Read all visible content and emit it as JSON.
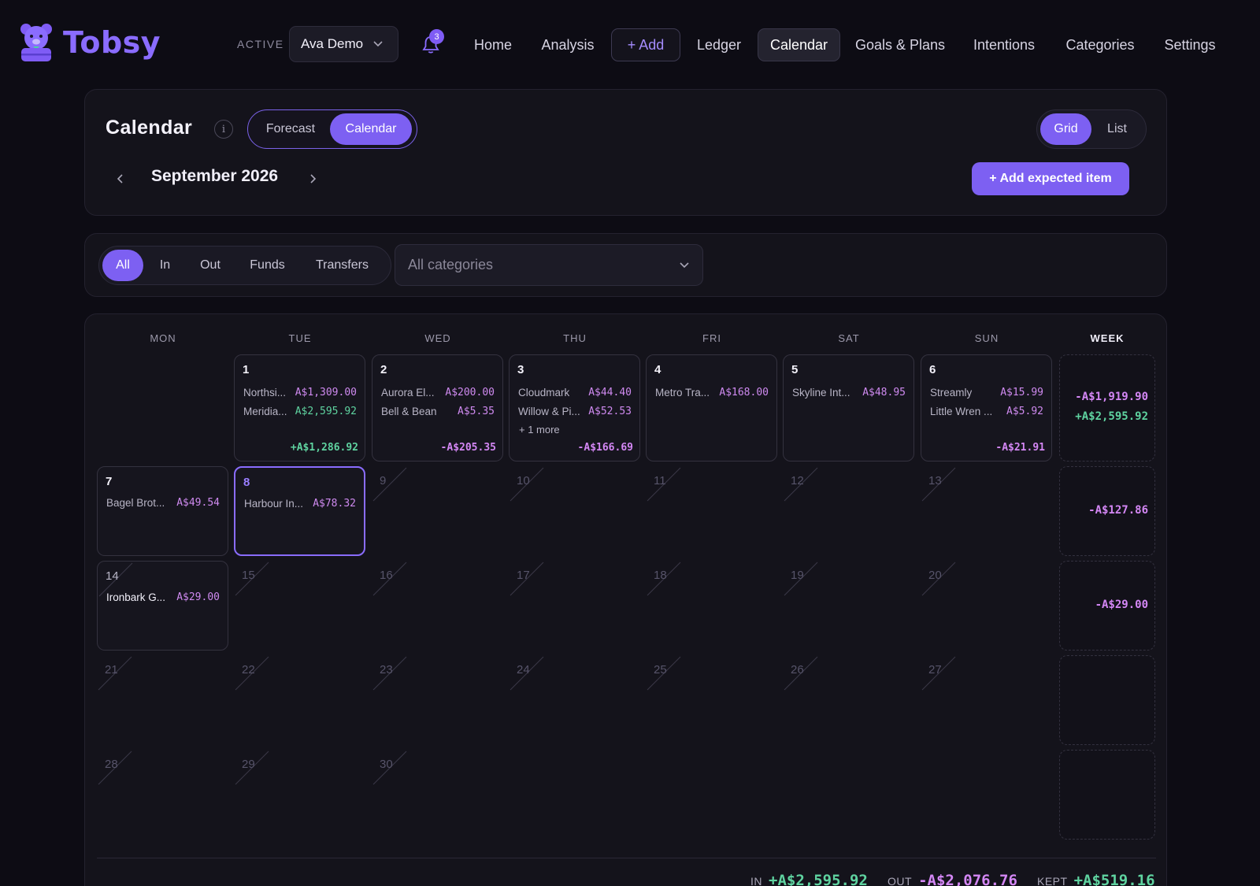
{
  "brand": {
    "name": "Tobsy"
  },
  "account": {
    "label": "ACTIVE",
    "selected": "Ava Demo"
  },
  "notifications": {
    "count": "3"
  },
  "nav": {
    "home": "Home",
    "analysis": "Analysis",
    "add": "+ Add",
    "ledger": "Ledger",
    "calendar": "Calendar",
    "goals": "Goals & Plans",
    "intentions": "Intentions",
    "categories": "Categories",
    "settings": "Settings"
  },
  "header": {
    "title": "Calendar",
    "info": "i",
    "modes": [
      "Forecast",
      "Calendar"
    ],
    "active_mode": "Calendar",
    "views": [
      "Grid",
      "List"
    ],
    "active_view": "Grid",
    "month": "September 2026",
    "add_expected": "+ Add expected item"
  },
  "filters": {
    "types": [
      "All",
      "In",
      "Out",
      "Funds",
      "Transfers"
    ],
    "active_type": "All",
    "category_placeholder": "All categories"
  },
  "weekdays": [
    "MON",
    "TUE",
    "WED",
    "THU",
    "FRI",
    "SAT",
    "SUN",
    "WEEK"
  ],
  "days": {
    "d1": {
      "num": "1",
      "entries": [
        {
          "name": "Northsi...",
          "amount": "A$1,309.00",
          "dir": "out"
        },
        {
          "name": "Meridia...",
          "amount": "A$2,595.92",
          "dir": "in"
        }
      ],
      "total": "+A$1,286.92"
    },
    "d2": {
      "num": "2",
      "entries": [
        {
          "name": "Aurora El...",
          "amount": "A$200.00",
          "dir": "out"
        },
        {
          "name": "Bell & Bean",
          "amount": "A$5.35",
          "dir": "out"
        }
      ],
      "total": "-A$205.35"
    },
    "d3": {
      "num": "3",
      "entries": [
        {
          "name": "Cloudmark",
          "amount": "A$44.40",
          "dir": "out"
        },
        {
          "name": "Willow & Pi...",
          "amount": "A$52.53",
          "dir": "out"
        }
      ],
      "more": "+ 1 more",
      "total": "-A$166.69"
    },
    "d4": {
      "num": "4",
      "entries": [
        {
          "name": "Metro Tra...",
          "amount": "A$168.00",
          "dir": "out"
        }
      ]
    },
    "d5": {
      "num": "5",
      "entries": [
        {
          "name": "Skyline Int...",
          "amount": "A$48.95",
          "dir": "out"
        }
      ]
    },
    "d6": {
      "num": "6",
      "entries": [
        {
          "name": "Streamly",
          "amount": "A$15.99",
          "dir": "out"
        },
        {
          "name": "Little Wren ...",
          "amount": "A$5.92",
          "dir": "out"
        }
      ],
      "total": "-A$21.91"
    },
    "d7": {
      "num": "7",
      "entries": [
        {
          "name": "Bagel Brot...",
          "amount": "A$49.54",
          "dir": "out"
        }
      ]
    },
    "d8": {
      "num": "8",
      "entries": [
        {
          "name": "Harbour In...",
          "amount": "A$78.32",
          "dir": "out"
        }
      ]
    },
    "d14": {
      "num": "14",
      "entries": [
        {
          "name": "Ironbark G...",
          "amount": "A$29.00",
          "dir": "out"
        }
      ]
    }
  },
  "empty_days": [
    "9",
    "10",
    "11",
    "12",
    "13",
    "15",
    "16",
    "17",
    "18",
    "19",
    "20",
    "21",
    "22",
    "23",
    "24",
    "25",
    "26",
    "27",
    "28",
    "29",
    "30"
  ],
  "weeks": {
    "w1": {
      "out": "-A$1,919.90",
      "in": "+A$2,595.92"
    },
    "w2": {
      "out": "-A$127.86"
    },
    "w3": {
      "out": "-A$29.00"
    }
  },
  "summary": {
    "in_label": "IN",
    "in_value": "+A$2,595.92",
    "out_label": "OUT",
    "out_value": "-A$2,076.76",
    "kept_label": "KEPT",
    "kept_value": "+A$519.16"
  },
  "colors": {
    "accent": "#7d60f2",
    "income": "#5fd3a0",
    "expense": "#d487f5",
    "background": "#0d0c14"
  }
}
